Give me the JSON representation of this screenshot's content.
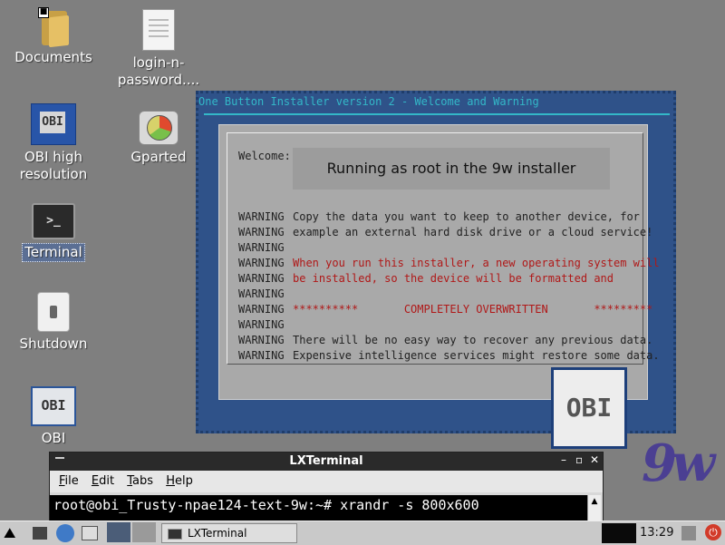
{
  "desktop": {
    "icons": [
      {
        "label": "Documents"
      },
      {
        "label": "login-n-\npassword...."
      },
      {
        "label": "OBI high\nresolution"
      },
      {
        "label": "Gparted"
      },
      {
        "label": "Terminal"
      },
      {
        "label": "Shutdown"
      },
      {
        "label": "OBI"
      }
    ]
  },
  "installer": {
    "title": "One Button Installer version  2 - Welcome and Warning",
    "welcome_label": "Welcome:",
    "headline": "Running as root in the 9w installer",
    "warn_word": "WARNING",
    "lines": [
      "Copy the data you want to keep to another device, for",
      "example an external hard disk drive or a cloud service!",
      "",
      "When you run this installer, a new operating system will",
      "be installed, so the device will be formatted and",
      "",
      "**********       COMPLETELY OVERWRITTEN       *********",
      "",
      "There will be no easy way to recover any previous data.",
      "Expensive intelligence services might restore some data."
    ],
    "logo_text": "OBI"
  },
  "brand": {
    "text": "9w"
  },
  "terminal": {
    "title": "LXTerminal",
    "menu": [
      "File",
      "Edit",
      "Tabs",
      "Help"
    ],
    "menu_hotkeys": [
      "F",
      "E",
      "T",
      "H"
    ],
    "prompt_line": "root@obi_Trusty-npae124-text-9w:~# xrandr -s 800x600"
  },
  "taskbar": {
    "app_label": "LXTerminal",
    "clock": "13:29"
  },
  "colors": {
    "desktop_bg": "#7f7f7f",
    "installer_bg": "#2f5289",
    "installer_title": "#33b8c8",
    "warning_red": "#b01818"
  }
}
